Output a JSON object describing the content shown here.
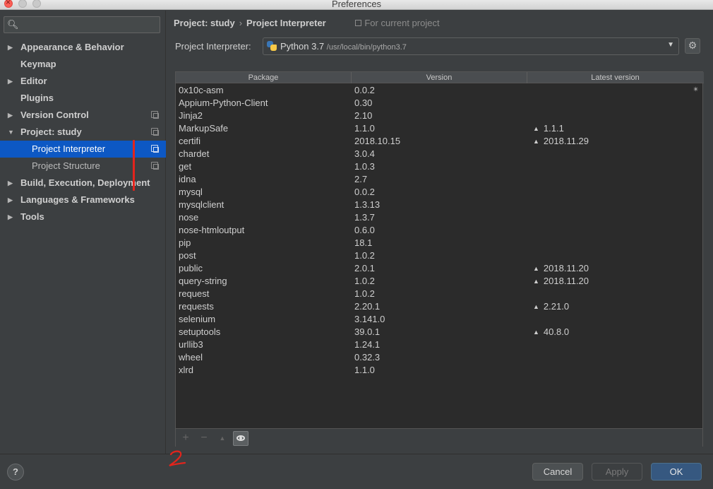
{
  "window": {
    "title": "Preferences"
  },
  "search": {
    "placeholder": ""
  },
  "sidebar": {
    "items": [
      {
        "label": "Appearance & Behavior",
        "expandable": true,
        "expanded": false
      },
      {
        "label": "Keymap",
        "expandable": false
      },
      {
        "label": "Editor",
        "expandable": true,
        "expanded": false
      },
      {
        "label": "Plugins",
        "expandable": false
      },
      {
        "label": "Version Control",
        "expandable": true,
        "expanded": false,
        "project_icon": true
      },
      {
        "label": "Project: study",
        "expandable": true,
        "expanded": true,
        "project_icon": true
      },
      {
        "label": "Project Interpreter",
        "child": true,
        "selected": true,
        "project_icon": true
      },
      {
        "label": "Project Structure",
        "child": true,
        "project_icon": true
      },
      {
        "label": "Build, Execution, Deployment",
        "expandable": true,
        "expanded": false
      },
      {
        "label": "Languages & Frameworks",
        "expandable": true,
        "expanded": false
      },
      {
        "label": "Tools",
        "expandable": true,
        "expanded": false
      }
    ]
  },
  "breadcrumb": {
    "parent": "Project: study",
    "separator": "›",
    "current": "Project Interpreter",
    "scope": "For current project"
  },
  "interpreter": {
    "label": "Project Interpreter:",
    "name": "Python 3.7",
    "path": "/usr/local/bin/python3.7"
  },
  "table": {
    "headers": [
      "Package",
      "Version",
      "Latest version"
    ],
    "rows": [
      {
        "package": "0x10c-asm",
        "version": "0.0.2",
        "latest": "",
        "loading": true
      },
      {
        "package": "Appium-Python-Client",
        "version": "0.30",
        "latest": ""
      },
      {
        "package": "Jinja2",
        "version": "2.10",
        "latest": ""
      },
      {
        "package": "MarkupSafe",
        "version": "1.1.0",
        "latest": "1.1.1"
      },
      {
        "package": "certifi",
        "version": "2018.10.15",
        "latest": "2018.11.29"
      },
      {
        "package": "chardet",
        "version": "3.0.4",
        "latest": ""
      },
      {
        "package": "get",
        "version": "1.0.3",
        "latest": ""
      },
      {
        "package": "idna",
        "version": "2.7",
        "latest": ""
      },
      {
        "package": "mysql",
        "version": "0.0.2",
        "latest": ""
      },
      {
        "package": "mysqlclient",
        "version": "1.3.13",
        "latest": ""
      },
      {
        "package": "nose",
        "version": "1.3.7",
        "latest": ""
      },
      {
        "package": "nose-htmloutput",
        "version": "0.6.0",
        "latest": ""
      },
      {
        "package": "pip",
        "version": "18.1",
        "latest": ""
      },
      {
        "package": "post",
        "version": "1.0.2",
        "latest": ""
      },
      {
        "package": "public",
        "version": "2.0.1",
        "latest": "2018.11.20"
      },
      {
        "package": "query-string",
        "version": "1.0.2",
        "latest": "2018.11.20"
      },
      {
        "package": "request",
        "version": "1.0.2",
        "latest": ""
      },
      {
        "package": "requests",
        "version": "2.20.1",
        "latest": "2.21.0"
      },
      {
        "package": "selenium",
        "version": "3.141.0",
        "latest": ""
      },
      {
        "package": "setuptools",
        "version": "39.0.1",
        "latest": "40.8.0"
      },
      {
        "package": "urllib3",
        "version": "1.24.1",
        "latest": ""
      },
      {
        "package": "wheel",
        "version": "0.32.3",
        "latest": ""
      },
      {
        "package": "xlrd",
        "version": "1.1.0",
        "latest": ""
      }
    ]
  },
  "toolbar": {
    "add": "+",
    "remove": "−",
    "upgrade": "▲",
    "show_early_releases": "eye-icon"
  },
  "footer": {
    "help": "?",
    "cancel": "Cancel",
    "apply": "Apply",
    "ok": "OK"
  },
  "colors": {
    "background": "#3c3f41",
    "table_background": "#2b2b2b",
    "selection": "#0d58c4",
    "ok_button": "#365880",
    "annotation": "#e3241c"
  }
}
